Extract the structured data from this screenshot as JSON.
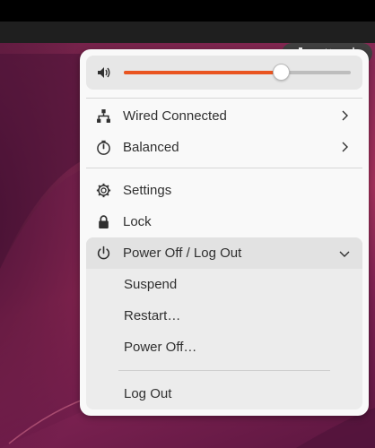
{
  "topbar": {
    "tray_icons": [
      "network-wired-icon",
      "speaker-icon",
      "power-icon"
    ]
  },
  "menu": {
    "volume": {
      "level_percent": 69,
      "icon": "speaker-icon"
    },
    "items": [
      {
        "label": "Wired Connected",
        "icon": "network-wired-icon",
        "has_submenu": true
      },
      {
        "label": "Balanced",
        "icon": "power-profile-icon",
        "has_submenu": true
      },
      {
        "label": "Settings",
        "icon": "settings-icon",
        "has_submenu": false
      },
      {
        "label": "Lock",
        "icon": "lock-icon",
        "has_submenu": false
      }
    ],
    "power": {
      "label": "Power Off / Log Out",
      "icon": "power-icon",
      "expanded": true,
      "sub_items": [
        {
          "label": "Suspend"
        },
        {
          "label": "Restart…"
        },
        {
          "label": "Power Off…"
        },
        {
          "label": "Log Out"
        }
      ]
    }
  },
  "colors": {
    "accent": "#e95420",
    "menu_bg": "#f9f9f9",
    "text": "#303030"
  }
}
